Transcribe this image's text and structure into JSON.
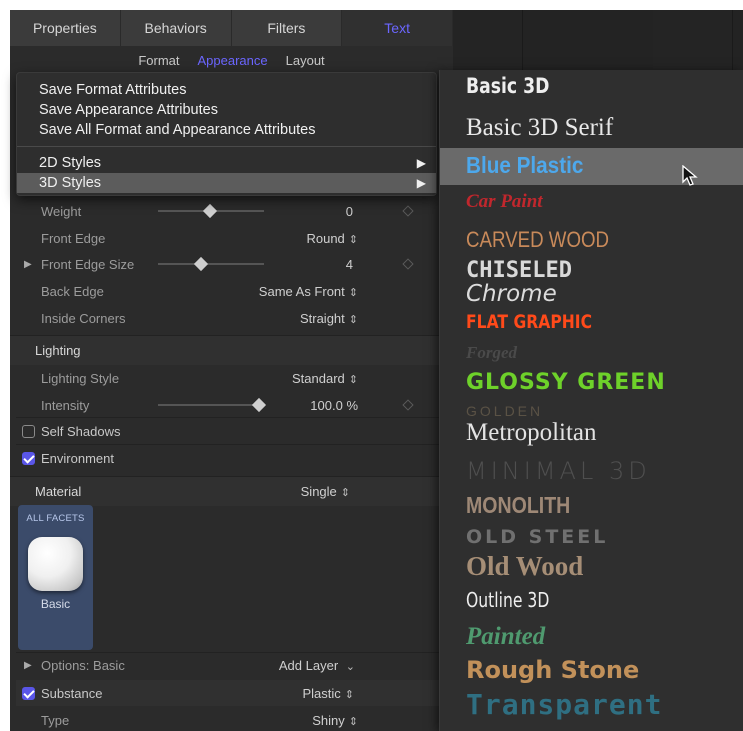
{
  "tabs": [
    {
      "label": "Properties"
    },
    {
      "label": "Behaviors"
    },
    {
      "label": "Filters"
    },
    {
      "label": "Text",
      "active": true
    }
  ],
  "subtabs": [
    {
      "label": "Format"
    },
    {
      "label": "Appearance",
      "active": true
    },
    {
      "label": "Layout"
    }
  ],
  "context_menu": {
    "items": [
      "Save Format Attributes",
      "Save Appearance Attributes",
      "Save All Format and Appearance Attributes"
    ],
    "submenus": [
      "2D Styles",
      "3D Styles"
    ],
    "highlighted": "3D Styles"
  },
  "params": {
    "weight": {
      "label": "Weight",
      "value": "0"
    },
    "front_edge": {
      "label": "Front Edge",
      "value": "Round"
    },
    "front_edge_size": {
      "label": "Front Edge Size",
      "value": "4"
    },
    "back_edge": {
      "label": "Back Edge",
      "value": "Same As Front"
    },
    "inside_corners": {
      "label": "Inside Corners",
      "value": "Straight"
    },
    "lighting": {
      "label": "Lighting"
    },
    "lighting_style": {
      "label": "Lighting Style",
      "value": "Standard"
    },
    "intensity": {
      "label": "Intensity",
      "value": "100.0",
      "unit": "%"
    },
    "self_shadows": {
      "label": "Self Shadows",
      "checked": false
    },
    "environment": {
      "label": "Environment",
      "checked": true
    },
    "material": {
      "label": "Material",
      "value": "Single"
    },
    "options": {
      "label": "Options: Basic",
      "value": "Add Layer"
    },
    "substance": {
      "label": "Substance",
      "value": "Plastic",
      "checked": true
    },
    "type": {
      "label": "Type",
      "value": "Shiny"
    }
  },
  "facet": {
    "header": "ALL FACETS",
    "label": "Basic"
  },
  "styles_menu": {
    "highlighted": "Blue Plastic",
    "items": [
      "Basic 3D",
      "Basic 3D Serif",
      "Blue Plastic",
      "Car Paint",
      "CARVED WOOD",
      "CHISELED",
      "Chrome",
      "FLAT GRAPHIC",
      "Forged",
      "GLOSSY GREEN",
      "GOLDEN",
      "Metropolitan",
      "MINIMAL 3D",
      "MONOLITH",
      "OLD STEEL",
      "Old Wood",
      "Outline 3D",
      "Painted",
      "Rough Stone",
      "Transparent"
    ]
  },
  "colors": {
    "accent": "#6b66ff",
    "highlight": "#5c5c5c",
    "checkbox": "#5a56e8"
  }
}
